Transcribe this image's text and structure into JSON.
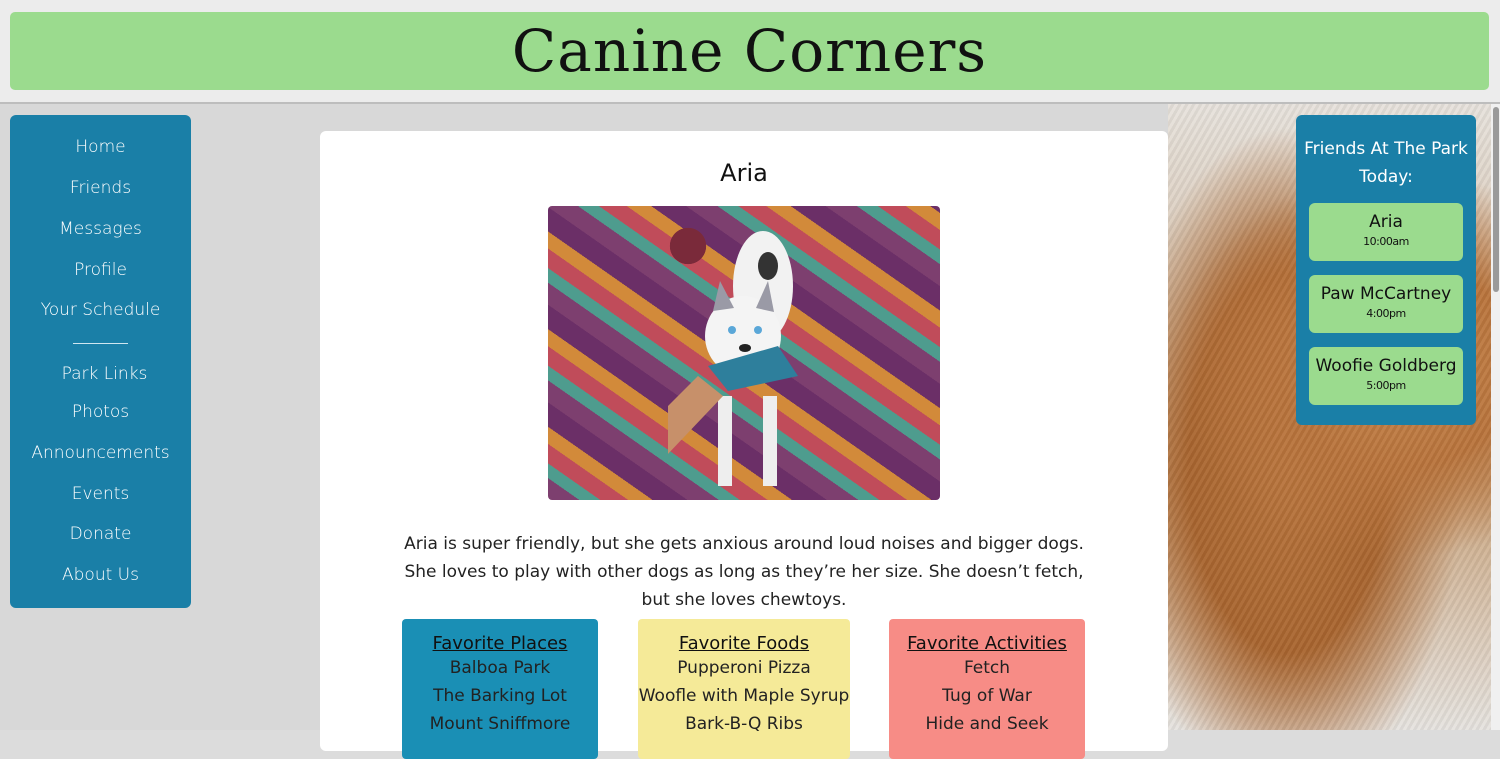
{
  "header": {
    "title": "Canine Corners"
  },
  "sidebar": {
    "items": [
      {
        "label": "Home"
      },
      {
        "label": "Friends"
      },
      {
        "label": "Messages"
      },
      {
        "label": "Profile"
      },
      {
        "label": "Your Schedule"
      }
    ],
    "secondary_items": [
      {
        "label": "Park Links"
      },
      {
        "label": "Photos"
      },
      {
        "label": "Announcements"
      },
      {
        "label": "Events"
      },
      {
        "label": "Donate"
      },
      {
        "label": "About Us"
      }
    ]
  },
  "profile": {
    "name": "Aria",
    "bio": "Aria is super friendly, but she gets anxious around loud noises and bigger dogs. She loves to play with other dogs as long as they’re her size. She doesn’t fetch, but she loves chewtoys.",
    "favorites": {
      "places": {
        "title": "Favorite Places",
        "items": [
          "Balboa Park",
          "The Barking Lot",
          "Mount Sniffmore"
        ]
      },
      "foods": {
        "title": "Favorite Foods",
        "items": [
          "Pupperoni Pizza",
          "Woofle with Maple Syrup",
          "Bark-B-Q Ribs"
        ]
      },
      "activities": {
        "title": "Favorite Activities",
        "items": [
          "Fetch",
          "Tug of War",
          "Hide and Seek"
        ]
      }
    }
  },
  "friends_panel": {
    "title": "Friends At The Park Today:",
    "friends": [
      {
        "name": "Aria",
        "time": "10:00am"
      },
      {
        "name": "Paw McCartney",
        "time": "4:00pm"
      },
      {
        "name": "Woofie Goldberg",
        "time": "5:00pm"
      }
    ]
  },
  "colors": {
    "header_bg": "#9bdb8e",
    "panel_blue": "#1a7fa7",
    "card_green": "#9bdb8e",
    "places_bg": "#1a8fb5",
    "foods_bg": "#f5ea98",
    "activities_bg": "#f78c86"
  }
}
